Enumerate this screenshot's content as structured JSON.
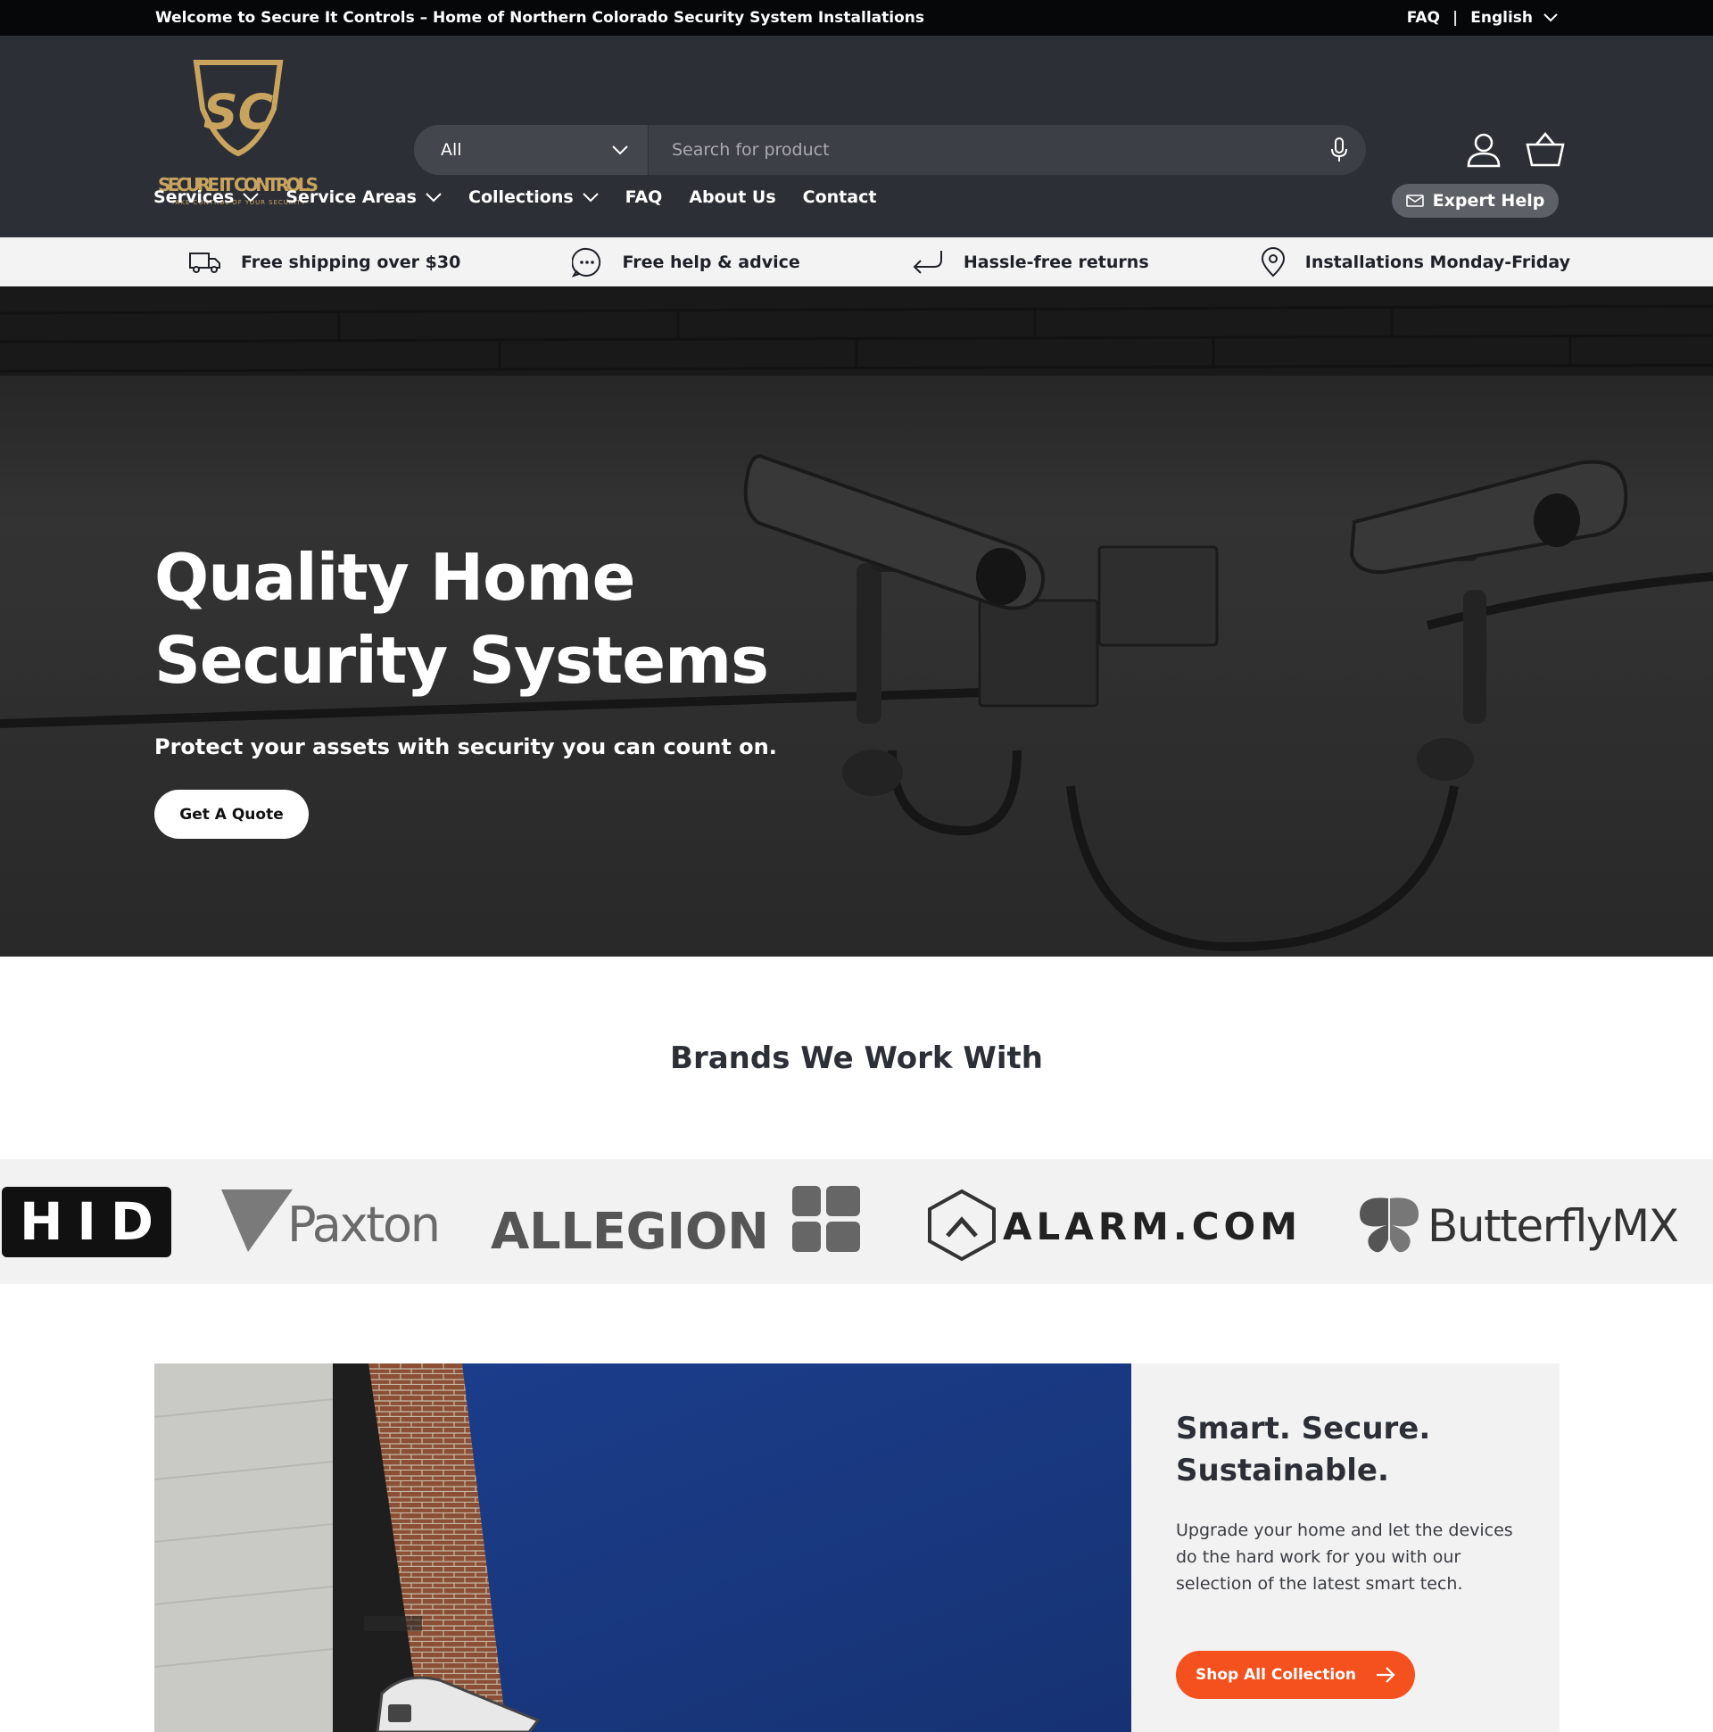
{
  "announcement": {
    "text": "Welcome to Secure It Controls – Home of Northern Colorado Security System Installations",
    "faq_link": "FAQ",
    "separator": "|",
    "language": "English"
  },
  "brand": {
    "logo_monogram": "SC",
    "logo_name": "SECURE IT CONTROLS",
    "logo_tagline": "TAKE CONTROL OF YOUR SECURITY"
  },
  "search": {
    "category": "All",
    "placeholder": "Search for product"
  },
  "nav": {
    "items": [
      {
        "label": "Services",
        "dropdown": true
      },
      {
        "label": "Service Areas",
        "dropdown": true
      },
      {
        "label": "Collections",
        "dropdown": true
      },
      {
        "label": "FAQ",
        "dropdown": false
      },
      {
        "label": "About Us",
        "dropdown": false
      },
      {
        "label": "Contact",
        "dropdown": false
      }
    ],
    "expert_help": "Expert Help"
  },
  "usp": [
    {
      "icon": "truck-icon",
      "label": "Free shipping over $30"
    },
    {
      "icon": "chat-icon",
      "label": "Free help & advice"
    },
    {
      "icon": "return-arrow-icon",
      "label": "Hassle-free returns"
    },
    {
      "icon": "map-pin-icon",
      "label": "Installations Monday-Friday"
    }
  ],
  "hero": {
    "title_line1": "Quality Home",
    "title_line2": "Security Systems",
    "subtitle": "Protect your assets with security you can count on.",
    "cta": "Get A Quote"
  },
  "brands": {
    "title": "Brands We Work With",
    "logos": [
      "HID",
      "Paxton",
      "ALLEGION",
      "ALARM.COM",
      "ButterflyMX"
    ]
  },
  "feature": {
    "title_line1": "Smart. Secure.",
    "title_line2": "Sustainable.",
    "body": "Upgrade your home and let the devices do the hard work for you with our selection of the latest smart tech.",
    "cta": "Shop All Collection"
  },
  "colors": {
    "announcement_bg": "#060709",
    "header_bg": "#2c2f36",
    "accent": "#f4511e",
    "logo_gold": "#c9a45e"
  }
}
